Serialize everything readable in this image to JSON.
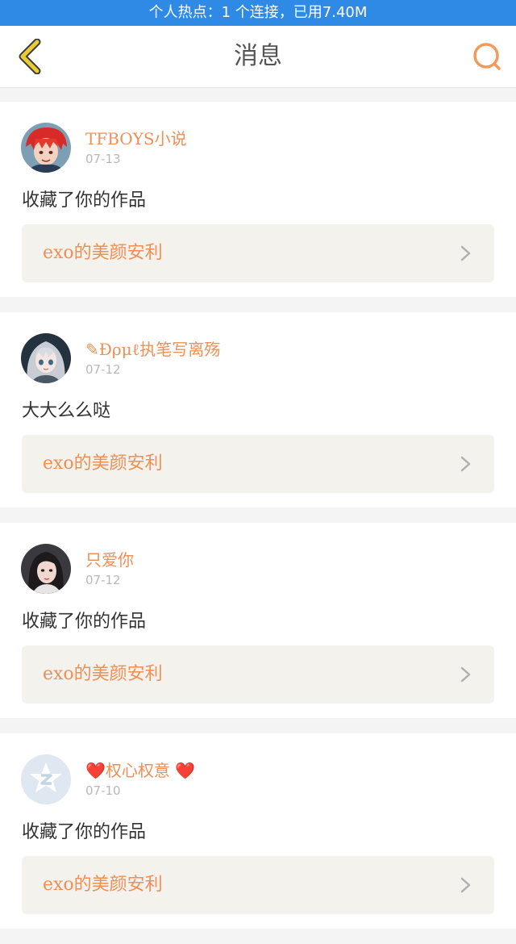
{
  "status_bar": {
    "text": "个人热点：1 个连接，已用7.40M"
  },
  "header": {
    "title": "消息",
    "back_icon": "chevron-left-icon",
    "search_icon": "search-icon",
    "colors": {
      "back": "#e9cb33",
      "search": "#f19a5a"
    }
  },
  "messages": [
    {
      "user": {
        "name": "TFBOYS小说",
        "prefix_heart": "",
        "suffix_heart": "",
        "avatar": "red-haired-anime-avatar"
      },
      "date": "07-13",
      "text": "收藏了你的作品",
      "work_title": "exo的美颜安利"
    },
    {
      "user": {
        "name": "✎Ðρμℓ执笔写离殇",
        "prefix_heart": "",
        "suffix_heart": "",
        "avatar": "silver-haired-anime-avatar"
      },
      "date": "07-12",
      "text": "大大么么哒",
      "work_title": "exo的美颜安利"
    },
    {
      "user": {
        "name": "只爱你",
        "prefix_heart": "",
        "suffix_heart": "",
        "avatar": "girl-photo-avatar"
      },
      "date": "07-12",
      "text": "收藏了你的作品",
      "work_title": "exo的美颜安利"
    },
    {
      "user": {
        "name": "权心权意",
        "prefix_heart": "❤️",
        "suffix_heart": " ❤️",
        "avatar": "default-z-star-avatar"
      },
      "date": "07-10",
      "text": "收藏了你的作品",
      "work_title": "exo的美颜安利"
    }
  ],
  "theme": {
    "accent": "#ef8f55",
    "status_bar": "#2f8ae5",
    "link_bg": "#f3f2ec"
  }
}
